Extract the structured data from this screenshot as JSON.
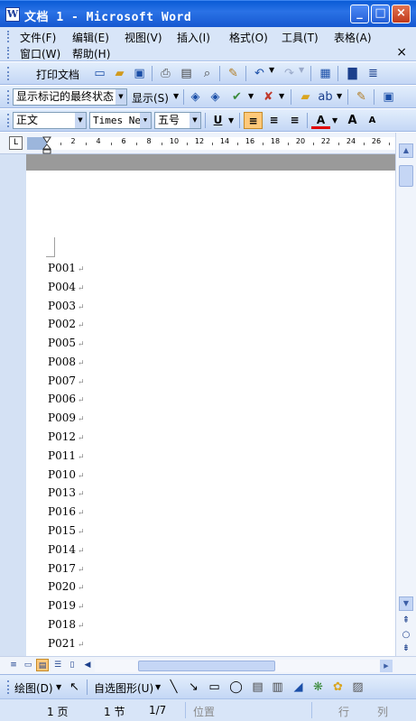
{
  "window": {
    "title": "文档 1 - Microsoft Word",
    "app_icon": "W",
    "minimize": "_",
    "maximize": "□",
    "close": "×"
  },
  "menu": {
    "row1": [
      "文件(F)",
      "编辑(E)",
      "视图(V)",
      "插入(I)",
      "格式(O)",
      "工具(T)",
      "表格(A)"
    ],
    "row2": [
      "窗口(W)",
      "帮助(H)"
    ],
    "close_doc": "×"
  },
  "toolbar_standard": {
    "print_document_label": "打印文档"
  },
  "toolbar_review": {
    "markup_mode": "显示标记的最终状态",
    "show_label": "显示(S)"
  },
  "toolbar_formatting": {
    "style": "正文",
    "font": "Times New",
    "size": "五号",
    "underline": "U",
    "font_color": "A",
    "grow": "A",
    "shrink": "A"
  },
  "ruler": {
    "ticks": [
      "2",
      "4",
      "6",
      "8",
      "10",
      "12",
      "14",
      "16",
      "18",
      "20",
      "22",
      "24",
      "26"
    ],
    "tab_selector": "L"
  },
  "document": {
    "lines": [
      "P001",
      "P004",
      "P003",
      "P002",
      "P005",
      "P008",
      "P007",
      "P006",
      "P009",
      "P012",
      "P011",
      "P010",
      "P013",
      "P016",
      "P015",
      "P014",
      "P017",
      "P020",
      "P019",
      "P018",
      "P021"
    ],
    "paragraph_mark": "↵"
  },
  "drawing_toolbar": {
    "draw_label": "绘图(D)",
    "autoshapes_label": "自选图形(U)"
  },
  "statusbar": {
    "page": "1 页",
    "section": "1 节",
    "page_of": "1/7",
    "position": "位置",
    "line": "行",
    "column": "列"
  }
}
